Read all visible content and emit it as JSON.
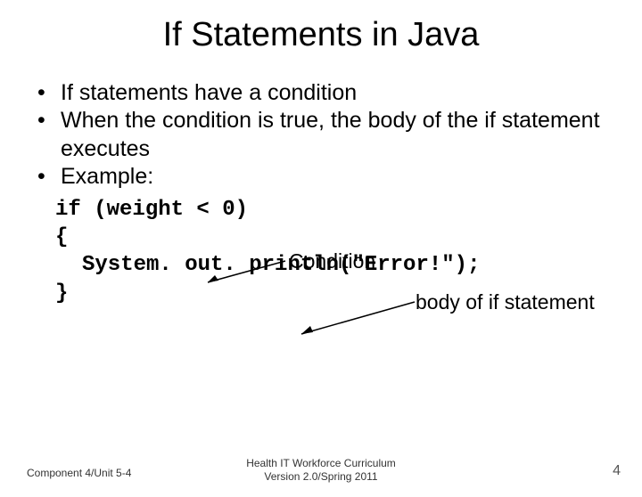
{
  "title": "If Statements in Java",
  "bullets": [
    "If statements have a condition",
    "When the condition is true, the body of the if statement executes",
    "Example:"
  ],
  "labels": {
    "condition": "Condition",
    "body": "body of if statement"
  },
  "code": {
    "l1": "if (weight < 0)",
    "l2": "{",
    "l3": "System. out. println(\"Error!\");",
    "l4": "}"
  },
  "footer": {
    "left": "Component 4/Unit 5-4",
    "center1": "Health IT Workforce Curriculum",
    "center2": "Version 2.0/Spring 2011",
    "page": "4"
  }
}
